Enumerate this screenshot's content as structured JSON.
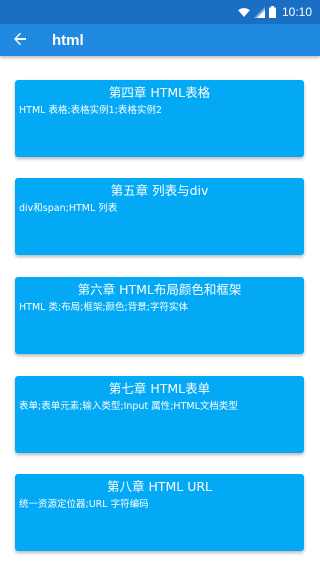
{
  "status_bar": {
    "time": "10:10",
    "icons": [
      "wifi-icon",
      "signal-icon",
      "battery-icon"
    ]
  },
  "app_bar": {
    "back_icon": "arrow-back-icon",
    "title": "html"
  },
  "colors": {
    "status_bar": "#1a6fc4",
    "app_bar": "#1f8ae0",
    "card": "#03a9f4",
    "text": "#ffffff"
  },
  "chapters": [
    {
      "title": "第四章  HTML表格",
      "subtitle": "HTML 表格;表格实例1;表格实例2"
    },
    {
      "title": "第五章  列表与div",
      "subtitle": "div和span;HTML 列表"
    },
    {
      "title": "第六章  HTML布局颜色和框架",
      "subtitle": "HTML 类;布局;框架;颜色;背景;字符实体"
    },
    {
      "title": "第七章  HTML表单",
      "subtitle": "表单;表单元素;输入类型;Input 属性;HTML文档类型"
    },
    {
      "title": "第八章  HTML URL",
      "subtitle": "统一资源定位器;URL 字符编码"
    }
  ]
}
